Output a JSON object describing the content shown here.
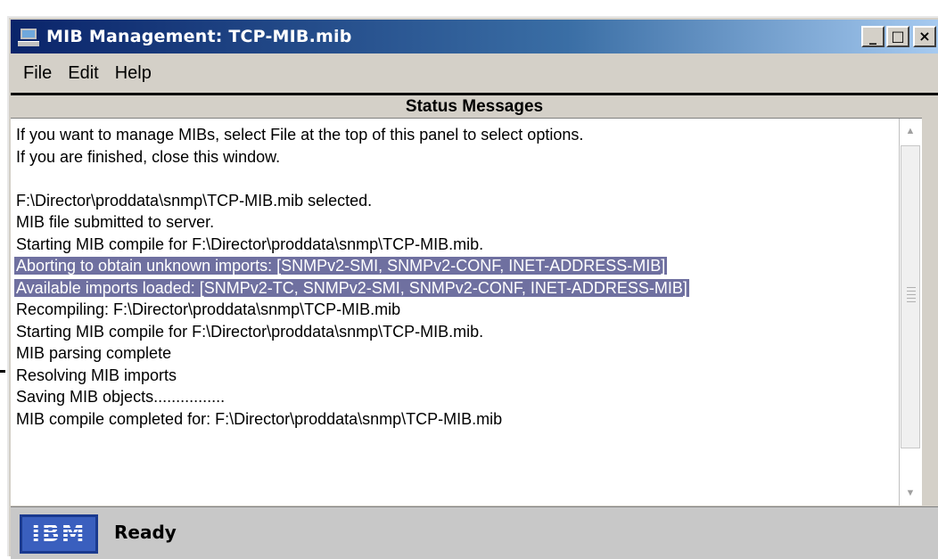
{
  "window": {
    "title": "MIB Management: TCP-MIB.mib",
    "minimize_label": "_",
    "maximize_label": "□",
    "close_label": "×"
  },
  "menu": {
    "items": [
      {
        "label": "File"
      },
      {
        "label": "Edit"
      },
      {
        "label": "Help"
      }
    ]
  },
  "panel": {
    "title": "Status Messages"
  },
  "messages": [
    {
      "text": "If you want to manage MIBs, select File at the top of this panel to select options.",
      "highlighted": false
    },
    {
      "text": "If you are finished, close this window.",
      "highlighted": false
    },
    {
      "text": "",
      "highlighted": false
    },
    {
      "text": "F:\\Director\\proddata\\snmp\\TCP-MIB.mib selected.",
      "highlighted": false
    },
    {
      "text": "MIB file submitted to server.",
      "highlighted": false
    },
    {
      "text": "Starting MIB compile for F:\\Director\\proddata\\snmp\\TCP-MIB.mib.",
      "highlighted": false
    },
    {
      "text": "Aborting to obtain unknown imports: [SNMPv2-SMI, SNMPv2-CONF, INET-ADDRESS-MIB]",
      "highlighted": true
    },
    {
      "text": "Available imports loaded: [SNMPv2-TC, SNMPv2-SMI, SNMPv2-CONF, INET-ADDRESS-MIB]",
      "highlighted": true
    },
    {
      "text": "Recompiling: F:\\Director\\proddata\\snmp\\TCP-MIB.mib",
      "highlighted": false
    },
    {
      "text": "Starting MIB compile for F:\\Director\\proddata\\snmp\\TCP-MIB.mib.",
      "highlighted": false
    },
    {
      "text": "MIB parsing complete",
      "highlighted": false
    },
    {
      "text": "Resolving MIB imports",
      "highlighted": false
    },
    {
      "text": "Saving MIB objects................",
      "highlighted": false
    },
    {
      "text": "MIB compile completed for: F:\\Director\\proddata\\snmp\\TCP-MIB.mib",
      "highlighted": false
    }
  ],
  "status": {
    "logo_text": "IBM",
    "text": "Ready"
  },
  "colors": {
    "highlight": "#6f70a0",
    "titlebar_start": "#0a246a",
    "titlebar_end": "#a6caf0",
    "logo": "#3a5fbe"
  }
}
